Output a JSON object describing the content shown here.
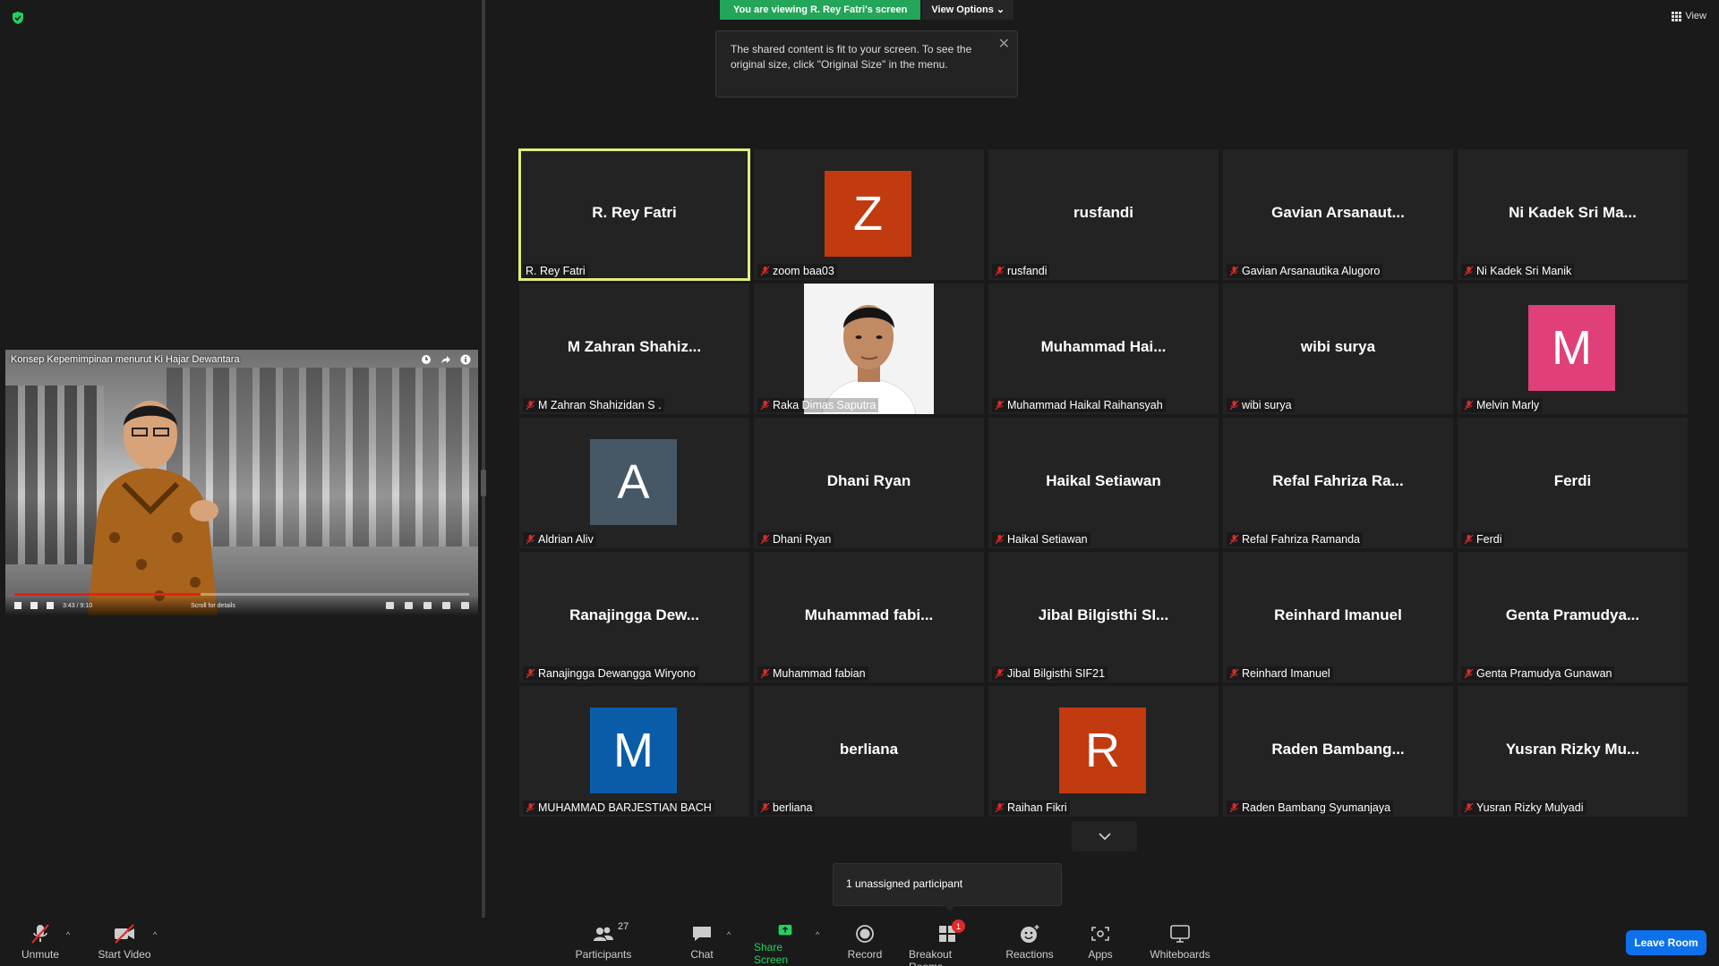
{
  "share": {
    "banner": "You are viewing R. Rey Fatri's screen",
    "view_options": "View Options",
    "tip": "The shared content is fit to your screen. To see the original size, click \"Original Size\" in the menu."
  },
  "view_label": "View",
  "video": {
    "title": "Konsep Kepemimpinan menurut Ki Hajar Dewantara",
    "time": "3:43 / 9:10",
    "scroll_hint": "Scroll for details",
    "progress": 0.41
  },
  "participants": [
    {
      "big": "R. Rey Fatri",
      "label": "R. Rey Fatri",
      "muted": false,
      "active": true
    },
    {
      "avatar": "Z",
      "color": "#c23a10",
      "label": "zoom baa03",
      "muted": true
    },
    {
      "big": "rusfandi",
      "label": "rusfandi",
      "muted": true
    },
    {
      "big": "Gavian  Arsanaut...",
      "label": "Gavian Arsanautika Alugoro",
      "muted": true
    },
    {
      "big": "Ni Kadek Sri Ma...",
      "label": "Ni Kadek Sri Manik",
      "muted": true
    },
    {
      "big": "M Zahran  Shahiz...",
      "label": "M Zahran Shahizidan S .",
      "muted": true
    },
    {
      "photo": true,
      "label": "Raka Dimas Saputra",
      "muted": true
    },
    {
      "big": "Muhammad  Hai...",
      "label": "Muhammad Haikal Raihansyah",
      "muted": true
    },
    {
      "big": "wibi surya",
      "label": "wibi surya",
      "muted": true
    },
    {
      "avatar": "M",
      "color": "#e0407a",
      "label": "Melvin Marly",
      "muted": true
    },
    {
      "avatar": "A",
      "color": "#465866",
      "label": "Aldrian Aliv",
      "muted": true
    },
    {
      "big": "Dhani Ryan",
      "label": "Dhani Ryan",
      "muted": true
    },
    {
      "big": "Haikal Setiawan",
      "label": "Haikal Setiawan",
      "muted": true
    },
    {
      "big": "Refal  Fahriza  Ra...",
      "label": "Refal Fahriza Ramanda",
      "muted": true
    },
    {
      "big": "Ferdi",
      "label": "Ferdi",
      "muted": true
    },
    {
      "big": "Ranajingga  Dew...",
      "label": "Ranajingga Dewangga Wiryono",
      "muted": true
    },
    {
      "big": "Muhammad  fabi...",
      "label": "Muhammad fabian",
      "muted": true
    },
    {
      "big": "Jibal  Bilgisthi  SI...",
      "label": "Jibal Bilgisthi SIF21",
      "muted": true
    },
    {
      "big": "Reinhard Imanuel",
      "label": "Reinhard Imanuel",
      "muted": true
    },
    {
      "big": "Genta  Pramudya...",
      "label": "Genta Pramudya Gunawan",
      "muted": true
    },
    {
      "avatar": "M",
      "color": "#0b5ca8",
      "label": "MUHAMMAD BARJESTIAN BACH",
      "muted": true
    },
    {
      "big": "berliana",
      "label": "berliana",
      "muted": true
    },
    {
      "avatar": "R",
      "color": "#c23a10",
      "label": "Raihan Fikri",
      "muted": true
    },
    {
      "big": "Raden  Bambang...",
      "label": "Raden Bambang Syumanjaya",
      "muted": true
    },
    {
      "big": "Yusran  Rizky  Mu...",
      "label": "Yusran Rizky Mulyadi",
      "muted": true
    }
  ],
  "unassigned": "1 unassigned participant",
  "toolbar": {
    "unmute": "Unmute",
    "start_video": "Start Video",
    "participants": "Participants",
    "participants_count": "27",
    "chat": "Chat",
    "share_screen": "Share Screen",
    "record": "Record",
    "breakout_rooms": "Breakout Rooms",
    "breakout_badge": "1",
    "reactions": "Reactions",
    "apps": "Apps",
    "whiteboards": "Whiteboards",
    "leave": "Leave Room"
  }
}
